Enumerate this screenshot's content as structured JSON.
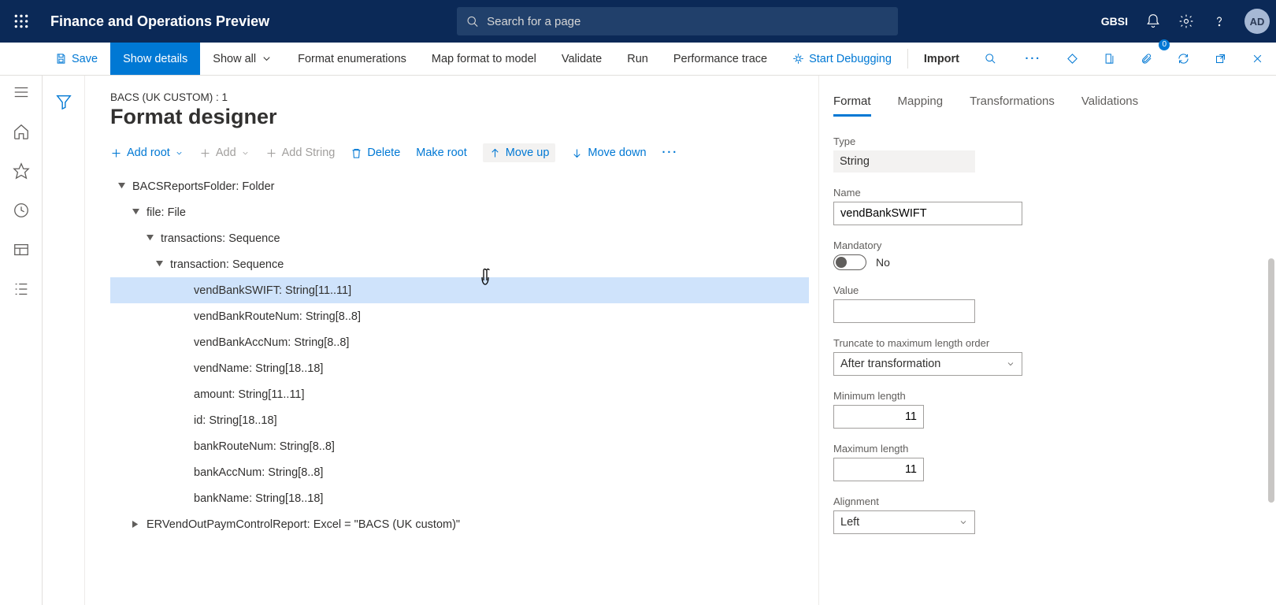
{
  "header": {
    "app_title": "Finance and Operations Preview",
    "search_placeholder": "Search for a page",
    "company": "GBSI",
    "avatar_initials": "AD"
  },
  "actionbar": {
    "save": "Save",
    "show_details": "Show details",
    "show_all": "Show all",
    "format_enum": "Format enumerations",
    "map_format": "Map format to model",
    "validate": "Validate",
    "run": "Run",
    "perf_trace": "Performance trace",
    "start_debug": "Start Debugging",
    "import": "Import",
    "attach_count": "0"
  },
  "page": {
    "breadcrumb": "BACS (UK CUSTOM) : 1",
    "title": "Format designer"
  },
  "tree_toolbar": {
    "add_root": "Add root",
    "add": "Add",
    "add_string": "Add String",
    "delete": "Delete",
    "make_root": "Make root",
    "move_up": "Move up",
    "move_down": "Move down"
  },
  "tree": {
    "n0": "BACSReportsFolder: Folder",
    "n1": "file: File",
    "n2": "transactions: Sequence",
    "n3": "transaction: Sequence",
    "n4": "vendBankSWIFT: String[11..11]",
    "n5": "vendBankRouteNum: String[8..8]",
    "n6": "vendBankAccNum: String[8..8]",
    "n7": "vendName: String[18..18]",
    "n8": "amount: String[11..11]",
    "n9": "id: String[18..18]",
    "n10": "bankRouteNum: String[8..8]",
    "n11": "bankAccNum: String[8..8]",
    "n12": "bankName: String[18..18]",
    "n13": "ERVendOutPaymControlReport: Excel = \"BACS (UK custom)\""
  },
  "right_tabs": {
    "format": "Format",
    "mapping": "Mapping",
    "transformations": "Transformations",
    "validations": "Validations"
  },
  "props": {
    "type_label": "Type",
    "type_value": "String",
    "name_label": "Name",
    "name_value": "vendBankSWIFT",
    "mandatory_label": "Mandatory",
    "mandatory_value": "No",
    "value_label": "Value",
    "value_value": "",
    "truncate_label": "Truncate to maximum length order",
    "truncate_value": "After transformation",
    "minlen_label": "Minimum length",
    "minlen_value": "11",
    "maxlen_label": "Maximum length",
    "maxlen_value": "11",
    "align_label": "Alignment",
    "align_value": "Left"
  }
}
